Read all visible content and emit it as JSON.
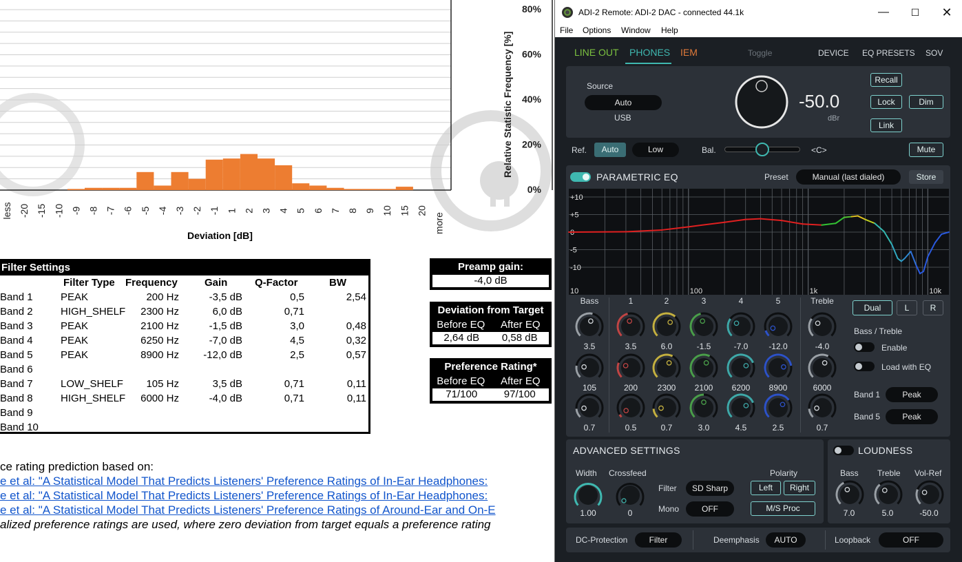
{
  "chart_data": {
    "type": "bar",
    "categories": [
      "less",
      "-20",
      "-15",
      "-10",
      "-9",
      "-8",
      "-7",
      "-6",
      "-5",
      "-4",
      "-3",
      "-2",
      "-1",
      "1",
      "2",
      "3",
      "4",
      "5",
      "6",
      "7",
      "8",
      "9",
      "10",
      "15",
      "20",
      "more"
    ],
    "values": [
      0,
      0,
      0,
      0,
      0.5,
      1,
      1,
      1,
      8,
      2,
      8,
      5,
      13.5,
      14,
      16,
      14,
      11,
      3,
      2,
      1,
      0.5,
      0.5,
      0.5,
      1.5,
      0,
      0
    ],
    "xlabel": "Deviation  [dB]",
    "ylabel": "Relative Statistic Frequency [%]",
    "yticks": [
      "0%",
      "20%",
      "40%",
      "60%",
      "80%"
    ],
    "ylim": [
      0,
      80
    ],
    "bar_color": "#ed7d31"
  },
  "doc": {
    "filter_title": "Filter Settings",
    "columns": [
      "Filter Type",
      "Frequency",
      "Gain",
      "Q-Factor",
      "BW"
    ],
    "bands": [
      {
        "band": "Band 1",
        "type": "PEAK",
        "freq": "200 Hz",
        "gain": "-3,5 dB",
        "q": "0,5",
        "bw": "2,54"
      },
      {
        "band": "Band 2",
        "type": "HIGH_SHELF",
        "freq": "2300 Hz",
        "gain": "6,0 dB",
        "q": "0,71",
        "bw": ""
      },
      {
        "band": "Band 3",
        "type": "PEAK",
        "freq": "2100 Hz",
        "gain": "-1,5 dB",
        "q": "3,0",
        "bw": "0,48"
      },
      {
        "band": "Band 4",
        "type": "PEAK",
        "freq": "6250 Hz",
        "gain": "-7,0 dB",
        "q": "4,5",
        "bw": "0,32"
      },
      {
        "band": "Band 5",
        "type": "PEAK",
        "freq": "8900 Hz",
        "gain": "-12,0 dB",
        "q": "2,5",
        "bw": "0,57"
      },
      {
        "band": "Band 6",
        "type": "",
        "freq": "",
        "gain": "",
        "q": "",
        "bw": ""
      },
      {
        "band": "Band 7",
        "type": "LOW_SHELF",
        "freq": "105 Hz",
        "gain": "3,5 dB",
        "q": "0,71",
        "bw": "0,11"
      },
      {
        "band": "Band 8",
        "type": "HIGH_SHELF",
        "freq": "6000 Hz",
        "gain": "-4,0 dB",
        "q": "0,71",
        "bw": "0,11"
      },
      {
        "band": "Band 9",
        "type": "",
        "freq": "",
        "gain": "",
        "q": "",
        "bw": ""
      },
      {
        "band": "Band 10",
        "type": "",
        "freq": "",
        "gain": "",
        "q": "",
        "bw": ""
      }
    ],
    "preamp_title": "Preamp gain:",
    "preamp_value": "-4,0 dB",
    "deviation_title": "Deviation from Target",
    "before_eq": "Before EQ",
    "after_eq": "After EQ",
    "deviation_before": "2,64 dB",
    "deviation_after": "0,58 dB",
    "pref_title": "Preference Rating*",
    "pref_before": "71/100",
    "pref_after": "97/100",
    "footnote": "ce rating prediction based on:",
    "links": [
      "e et al: \"A Statistical Model That Predicts Listeners' Preference Ratings of In-Ear Headphones:",
      "e et al: \"A Statistical Model That Predicts Listeners' Preference Ratings of In-Ear Headphones:",
      "e et al: \"A Statistical Model That Predicts Listeners' Preference Ratings of Around-Ear and On-E"
    ],
    "italic_note": "alized preference ratings are used, where zero deviation from target equals a preference rating"
  },
  "app": {
    "title": "ADI-2 Remote: ADI-2 DAC - connected 44.1k",
    "menu": [
      "File",
      "Options",
      "Window",
      "Help"
    ],
    "tabs": {
      "line_out": "LINE OUT",
      "phones": "PHONES",
      "iem": "IEM",
      "toggle": "Toggle",
      "device": "DEVICE",
      "eq_presets": "EQ PRESETS",
      "sov": "SOV"
    },
    "colors": {
      "line_out": "#7cc240",
      "phones": "#3fb8b0",
      "iem": "#e07a3a"
    },
    "source_label": "Source",
    "source_value": "Auto",
    "source_sub": "USB",
    "volume": "-50.0",
    "volume_unit": "dBr",
    "recall": "Recall",
    "lock": "Lock",
    "dim": "Dim",
    "link": "Link",
    "ref_label": "Ref.",
    "ref_auto": "Auto",
    "ref_low": "Low",
    "bal_label": "Bal.",
    "bal_value": "<C>",
    "mute": "Mute",
    "peq_title": "PARAMETRIC EQ",
    "preset_label": "Preset",
    "preset_value": "Manual (last dialed)",
    "store": "Store",
    "eq_y_labels": [
      "+10",
      "+5",
      "0",
      "-5",
      "-10"
    ],
    "eq_x_labels": [
      "10",
      "100",
      "1k",
      "10k"
    ],
    "eq_cols": {
      "bass": "Bass",
      "b1": "1",
      "b2": "2",
      "b3": "3",
      "b4": "4",
      "b5": "5",
      "treble": "Treble"
    },
    "gain_vals": {
      "bass": "3.5",
      "b1": "3.5",
      "b2": "6.0",
      "b3": "-1.5",
      "b4": "-7.0",
      "b5": "-12.0",
      "treble": "-4.0"
    },
    "freq_vals": {
      "bass": "105",
      "b1": "200",
      "b2": "2300",
      "b3": "2100",
      "b4": "6200",
      "b5": "8900",
      "treble": "6000"
    },
    "q_vals": {
      "bass": "0.7",
      "b1": "0.5",
      "b2": "0.7",
      "b3": "3.0",
      "b4": "4.5",
      "b5": "2.5",
      "treble": "0.7"
    },
    "dual": "Dual",
    "l": "L",
    "r": "R",
    "bass_treble": "Bass / Treble",
    "enable": "Enable",
    "load_with_eq": "Load with EQ",
    "band1_label": "Band 1",
    "band1_value": "Peak",
    "band5_label": "Band 5",
    "band5_value": "Peak",
    "adv_title": "ADVANCED SETTINGS",
    "width_label": "Width",
    "width_value": "1.00",
    "crossfeed_label": "Crossfeed",
    "crossfeed_value": "0",
    "filter_label": "Filter",
    "filter_value": "SD Sharp",
    "mono_label": "Mono",
    "mono_value": "OFF",
    "polarity_label": "Polarity",
    "left": "Left",
    "right": "Right",
    "ms_proc": "M/S Proc",
    "loud_title": "LOUDNESS",
    "loud_bass": "Bass",
    "loud_bass_val": "7.0",
    "loud_treble": "Treble",
    "loud_treble_val": "5.0",
    "loud_volref": "Vol-Ref",
    "loud_volref_val": "-50.0",
    "dc_label": "DC-Protection",
    "dc_value": "Filter",
    "deemph_label": "Deemphasis",
    "deemph_value": "AUTO",
    "loopback_label": "Loopback",
    "loopback_value": "OFF"
  }
}
